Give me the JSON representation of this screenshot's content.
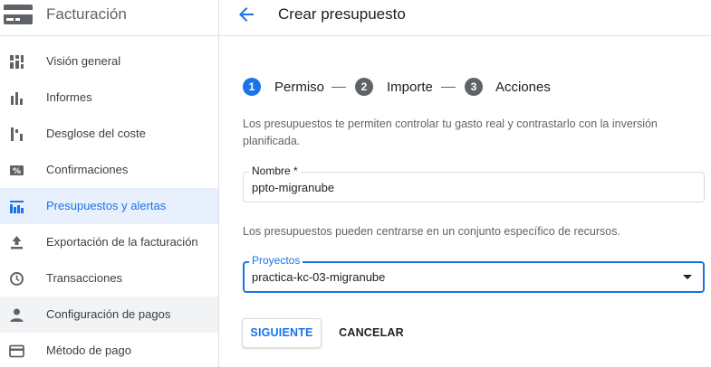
{
  "sidebar": {
    "title": "Facturación",
    "items": [
      {
        "label": "Visión general",
        "icon": "dashboard-grid-icon"
      },
      {
        "label": "Informes",
        "icon": "bar-chart-icon"
      },
      {
        "label": "Desglose del coste",
        "icon": "cost-breakdown-icon"
      },
      {
        "label": "Confirmaciones",
        "icon": "percent-icon"
      },
      {
        "label": "Presupuestos y alertas",
        "icon": "budget-chart-icon",
        "active": true
      },
      {
        "label": "Exportación de la facturación",
        "icon": "export-icon"
      },
      {
        "label": "Transacciones",
        "icon": "clock-icon"
      },
      {
        "label": "Configuración de pagos",
        "icon": "person-icon"
      },
      {
        "label": "Método de pago",
        "icon": "credit-card-icon"
      }
    ]
  },
  "header": {
    "title": "Crear presupuesto",
    "back_icon": "arrow-back-icon"
  },
  "stepper": {
    "steps": [
      {
        "number": "1",
        "label": "Permiso",
        "active": true
      },
      {
        "number": "2",
        "label": "Importe",
        "active": false
      },
      {
        "number": "3",
        "label": "Acciones",
        "active": false
      }
    ]
  },
  "form": {
    "intro_line1": "Los presupuestos te permiten controlar tu gasto real y contrastarlo con la inversión",
    "intro_line2": "planificada.",
    "name_label": "Nombre *",
    "name_value": "ppto-migranube",
    "scope_text": "Los presupuestos pueden centrarse en un conjunto específico de recursos.",
    "projects_label": "Proyectos",
    "projects_value": "practica-kc-03-migranube"
  },
  "actions": {
    "next_label": "SIGUIENTE",
    "cancel_label": "CANCELAR"
  },
  "colors": {
    "accent": "#1a73e8",
    "active_bg": "#e8f0fe",
    "step_inactive": "#5f6368",
    "text_secondary": "#5f6368"
  }
}
